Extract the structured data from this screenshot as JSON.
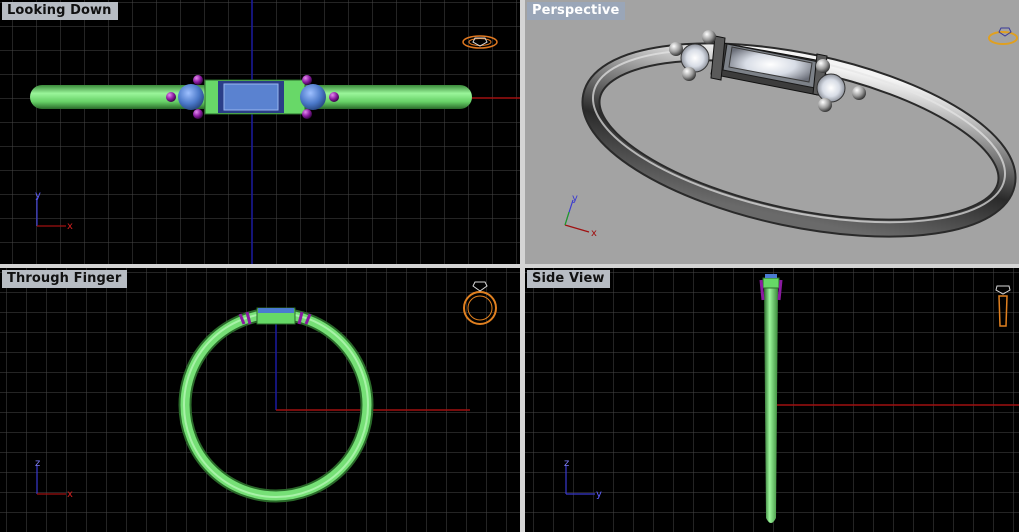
{
  "viewports": [
    {
      "name": "top",
      "title": "Looking Down",
      "active": false,
      "axes": [
        "y",
        "x"
      ]
    },
    {
      "name": "perspective",
      "title": "Perspective",
      "active": true,
      "axes": [
        "y",
        "x"
      ]
    },
    {
      "name": "front",
      "title": "Through Finger",
      "active": false,
      "axes": [
        "z",
        "x"
      ]
    },
    {
      "name": "side",
      "title": "Side View",
      "active": false,
      "axes": [
        "z",
        "y"
      ]
    }
  ],
  "colors": {
    "viewport_background": "#000000",
    "perspective_background": "#a3a3a3",
    "grid_line": "#4a4a4a",
    "major_axis_red": "#8a1010",
    "major_axis_blue": "#1a1a9a",
    "ring_green": "#66e066",
    "stone_blue": "#5580d0",
    "prong_purple": "#8a1aa0",
    "metal_silver": "#cfcfcf",
    "divider": "#d0d0d0"
  },
  "icons": [
    "ring-top-icon",
    "ring-perspective-icon",
    "ring-front-icon",
    "ring-side-icon"
  ]
}
